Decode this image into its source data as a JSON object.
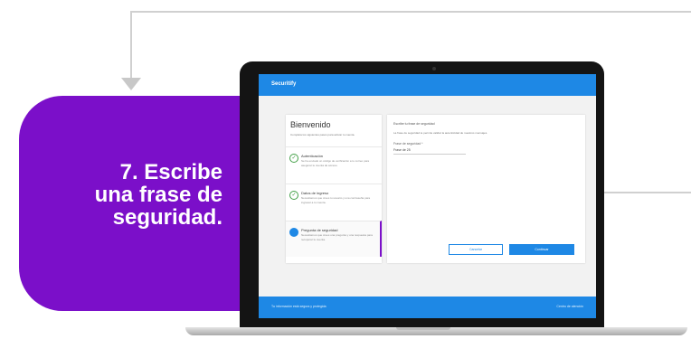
{
  "callout": {
    "text": "7. Escribe\nuna frase de\nseguridad.",
    "color": "#7b0fc9"
  },
  "app": {
    "brand": "Securitify",
    "accent": "#1e88e5"
  },
  "steps_panel": {
    "title": "Bienvenido",
    "subtitle": "Completa los siguientes pasos para activar tu cuenta.",
    "steps": [
      {
        "title": "Autenticación",
        "desc": "Se ha enviado un código de verificación a tu correo para asegurar tu cuenta de acceso.",
        "state": "done"
      },
      {
        "title": "Datos de ingreso",
        "desc": "Necesitamos que crees tu usuario y una contraseña para ingresar a tu cuenta.",
        "state": "done"
      },
      {
        "title": "Pregunta de seguridad",
        "desc": "Necesitamos que crees una pregunta y una respuesta para recuperar tu cuenta.",
        "state": "active"
      }
    ]
  },
  "form": {
    "heading": "Escribe tu frase de seguridad",
    "description": "La frase de seguridad te permite validar la autenticidad de nuestros mensajes.",
    "phrase_label": "Frase de seguridad *",
    "phrase_value": "Frase de 25",
    "cancel_label": "Cancelar",
    "continue_label": "Continuar"
  },
  "footer": {
    "left": "Tu información está segura y protegida",
    "right": "Centro de atención"
  }
}
